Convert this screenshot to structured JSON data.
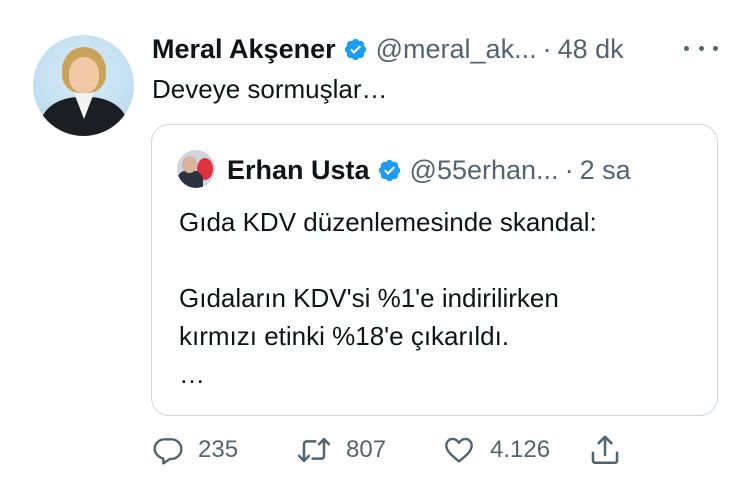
{
  "tweet": {
    "author_name": "Meral Akşener",
    "author_handle": "@meral_ak...",
    "separator": "·",
    "time": "48 dk",
    "text": "Deveye sormuşlar…"
  },
  "quoted": {
    "author_name": "Erhan Usta",
    "author_handle": "@55erhan...",
    "separator": "·",
    "time": "2 sa",
    "text": "Gıda KDV düzenlemesinde skandal:\n\nGıdaların KDV'si %1'e indirilirken\nkırmızı etinki %18'e çıkarıldı.\n…"
  },
  "actions": {
    "reply_count": "235",
    "retweet_count": "807",
    "like_count": "4.126"
  },
  "colors": {
    "verified": "#1d9bf0",
    "muted": "#536471",
    "border": "#cfd9de"
  },
  "icons": [
    "verified-badge-icon",
    "more-icon",
    "reply-icon",
    "retweet-icon",
    "like-icon",
    "share-icon"
  ]
}
